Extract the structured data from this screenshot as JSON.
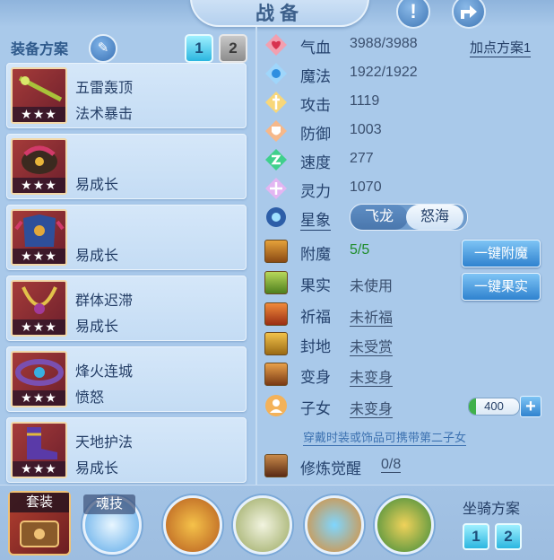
{
  "header": {
    "title": "战备",
    "info_icon": "exclamation-icon",
    "share_icon": "share-icon"
  },
  "equip_plan": {
    "title": "装备方案",
    "edit_icon": "pencil-icon",
    "tabs": [
      "1",
      "2"
    ],
    "items": [
      {
        "name": "五雷轰顶",
        "sub": "法术暴击",
        "stars": "★★★"
      },
      {
        "name": "",
        "sub": "易成长",
        "stars": "★★★"
      },
      {
        "name": "",
        "sub": "易成长",
        "stars": "★★★"
      },
      {
        "name": "群体迟滞",
        "sub": "易成长",
        "stars": "★★★"
      },
      {
        "name": "烽火连城",
        "sub": "愤怒",
        "stars": "★★★"
      },
      {
        "name": "天地护法",
        "sub": "易成长",
        "stars": "★★★"
      }
    ]
  },
  "stats": {
    "plan_link": "加点方案1",
    "rows": [
      {
        "label": "气血",
        "value": "3988/3988",
        "icon": "heart-icon",
        "color": "#e0576f"
      },
      {
        "label": "魔法",
        "value": "1922/1922",
        "icon": "mana-icon",
        "color": "#4aa8e8"
      },
      {
        "label": "攻击",
        "value": "1119",
        "icon": "sword-icon",
        "color": "#f0b63a"
      },
      {
        "label": "防御",
        "value": "1003",
        "icon": "shield-icon",
        "color": "#f08a3a"
      },
      {
        "label": "速度",
        "value": "277",
        "icon": "speed-icon",
        "color": "#2fc07a"
      },
      {
        "label": "灵力",
        "value": "1070",
        "icon": "spirit-icon",
        "color": "#c97ee0"
      }
    ],
    "star_label": "星象",
    "star_options": [
      "飞龙",
      "怒海"
    ]
  },
  "features": [
    {
      "label": "附魔",
      "value": "5/5",
      "icon": "enchant-icon"
    },
    {
      "label": "果实",
      "value": "未使用",
      "icon": "fruit-icon"
    },
    {
      "label": "祈福",
      "value": "未祈福",
      "icon": "blessing-icon"
    },
    {
      "label": "封地",
      "value": "未受赏",
      "icon": "fief-icon"
    },
    {
      "label": "变身",
      "value": "未变身",
      "icon": "transform-icon"
    },
    {
      "label": "子女",
      "value": "未变身",
      "icon": "child-icon"
    }
  ],
  "actions": {
    "enchant": "一键附魔",
    "fruit": "一键果实"
  },
  "child_counter": {
    "value": "400",
    "plus": "+"
  },
  "hint": "穿戴时装或饰品可携带第二子女",
  "cultivation": {
    "label": "修炼觉醒",
    "value": "0/8",
    "icon": "cultivation-icon"
  },
  "bottom": {
    "suit_label": "套装",
    "soul_label": "魂技",
    "mount_title": "坐骑方案",
    "mount_tabs": [
      "1",
      "2"
    ]
  }
}
